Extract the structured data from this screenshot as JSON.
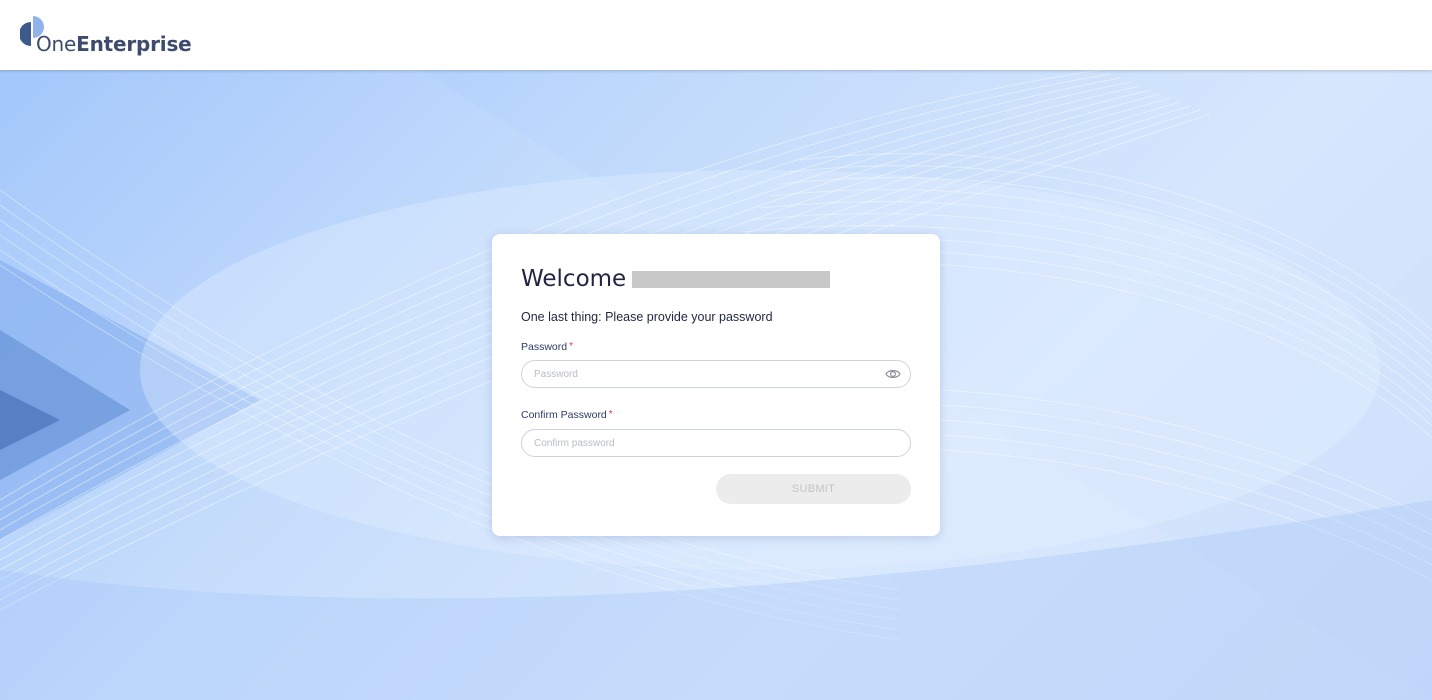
{
  "header": {
    "logo": {
      "text_light": "One",
      "text_bold": "Enterprise",
      "color": "#3d4b6e",
      "mark_color": "#3d5a8c",
      "mark_accent": "#9cc3fb"
    }
  },
  "card": {
    "welcome": "Welcome",
    "subtitle": "One last thing: Please provide your password",
    "password": {
      "label": "Password",
      "required_mark": "*",
      "placeholder": "Password",
      "value": "",
      "reveal_icon": "eye-icon"
    },
    "confirm_password": {
      "label": "Confirm Password",
      "required_mark": "*",
      "placeholder": "Confirm password",
      "value": ""
    },
    "submit_label": "SUBMIT"
  },
  "colors": {
    "background_blue": "#9cc3fb",
    "text_dark": "#1f2640",
    "label_blue": "#2d3a66",
    "required_red": "#e0344a",
    "disabled_button": "#ececec"
  }
}
